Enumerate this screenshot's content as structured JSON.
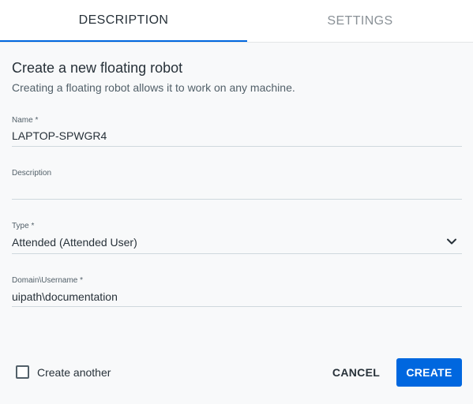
{
  "tabs": [
    {
      "label": "DESCRIPTION",
      "active": true
    },
    {
      "label": "SETTINGS",
      "active": false
    }
  ],
  "heading": {
    "title": "Create a new floating robot",
    "subtitle": "Creating a floating robot allows it to work on any machine."
  },
  "form": {
    "name": {
      "label": "Name *",
      "value": "LAPTOP-SPWGR4"
    },
    "description": {
      "label": "Description",
      "value": ""
    },
    "type": {
      "label": "Type *",
      "value": "Attended (Attended User)"
    },
    "username": {
      "label": "Domain\\Username *",
      "value": "uipath\\documentation"
    }
  },
  "footer": {
    "create_another_label": "Create another",
    "create_another_checked": false,
    "cancel_label": "CANCEL",
    "create_label": "CREATE"
  },
  "colors": {
    "accent": "#0067df",
    "text": "#273139",
    "muted": "#8a9197"
  },
  "icons": {
    "type_dropdown": "chevron-down-icon"
  }
}
